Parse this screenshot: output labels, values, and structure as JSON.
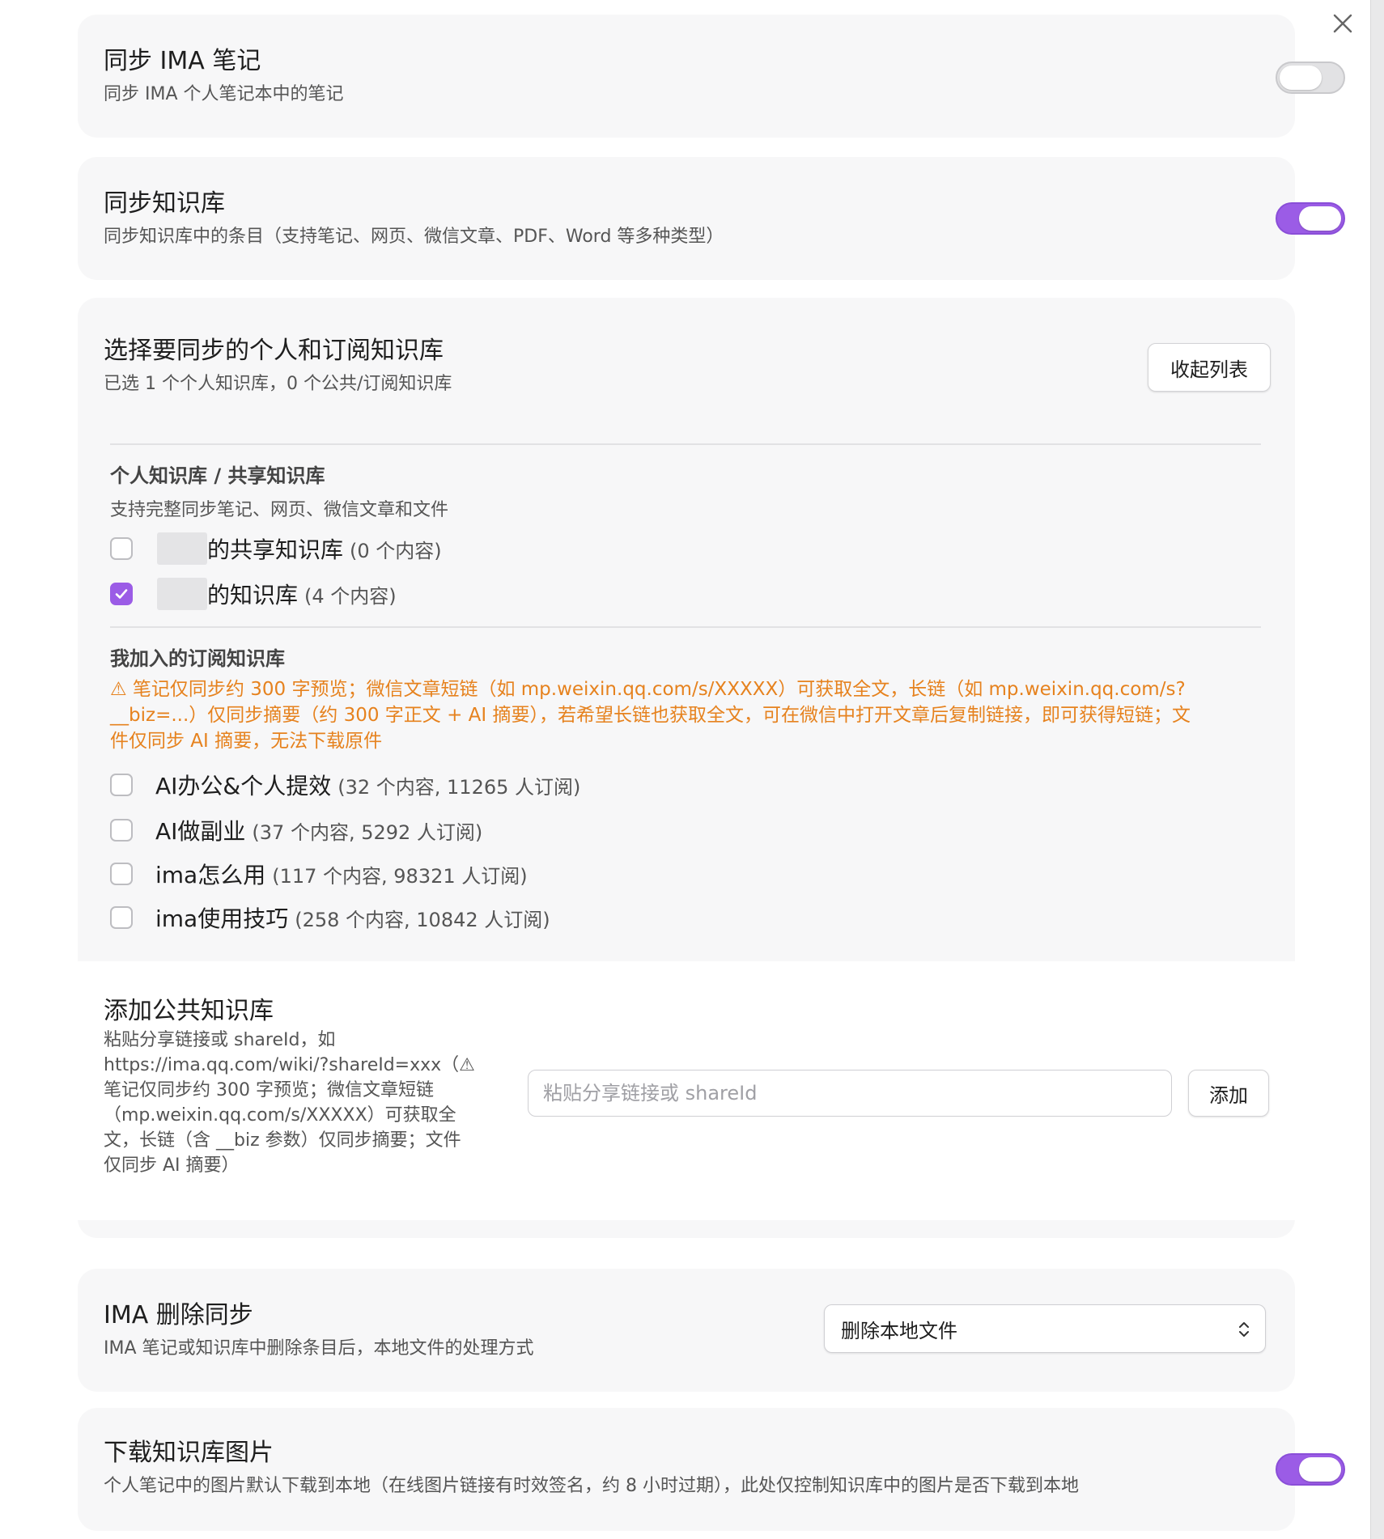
{
  "sync_notes": {
    "title": "同步 IMA 笔记",
    "desc": "同步 IMA 个人笔记本中的笔记",
    "enabled": false
  },
  "sync_kb": {
    "title": "同步知识库",
    "desc": "同步知识库中的条目（支持笔记、网页、微信文章、PDF、Word 等多种类型）",
    "enabled": true
  },
  "select_kb": {
    "title": "选择要同步的个人和订阅知识库",
    "desc": "已选 1 个个人知识库，0 个公共/订阅知识库",
    "collapse_label": "收起列表"
  },
  "personal": {
    "heading": "个人知识库 / 共享知识库",
    "desc": "支持完整同步笔记、网页、微信文章和文件",
    "items": [
      {
        "name": "的共享知识库",
        "meta": "(0 个内容)",
        "checked": false
      },
      {
        "name": "的知识库",
        "meta": "(4 个内容)",
        "checked": true
      }
    ]
  },
  "subscribed": {
    "heading": "我加入的订阅知识库",
    "warning_line1": "⚠ 笔记仅同步约 300 字预览；微信文章短链（如 mp.weixin.qq.com/s/XXXXX）可获取全文，长链（如 mp.weixin.qq.com/s?",
    "warning_line2": "__biz=...）仅同步摘要（约 300 字正文 + AI 摘要），若希望长链也获取全文，可在微信中打开文章后复制链接，即可获得短链；文",
    "warning_line3": "件仅同步 AI 摘要，无法下载原件",
    "items": [
      {
        "name": "AI办公&个人提效",
        "meta": "(32 个内容, 11265 人订阅)",
        "checked": false
      },
      {
        "name": "AI做副业",
        "meta": "(37 个内容, 5292 人订阅)",
        "checked": false
      },
      {
        "name": "ima怎么用",
        "meta": "(117 个内容, 98321 人订阅)",
        "checked": false
      },
      {
        "name": "ima使用技巧",
        "meta": "(258 个内容, 10842 人订阅)",
        "checked": false
      }
    ]
  },
  "add_public": {
    "title": "添加公共知识库",
    "desc_lines": [
      "粘贴分享链接或 shareId，如",
      "https://ima.qq.com/wiki/?shareId=xxx（⚠",
      "笔记仅同步约 300 字预览；微信文章短链",
      "（mp.weixin.qq.com/s/XXXXX）可获取全",
      "文，长链（含 __biz 参数）仅同步摘要；文件",
      "仅同步 AI 摘要）"
    ],
    "input_value": "",
    "input_placeholder": "粘贴分享链接或 shareId",
    "add_label": "添加"
  },
  "delete_sync": {
    "title": "IMA 删除同步",
    "desc": "IMA 笔记或知识库中删除条目后，本地文件的处理方式",
    "selected": "删除本地文件"
  },
  "download_images": {
    "title": "下载知识库图片",
    "desc": "个人笔记中的图片默认下载到本地（在线图片链接有时效签名，约 8 小时过期），此处仅控制知识库中的图片是否下载到本地",
    "enabled": true
  },
  "colors": {
    "accent": "#9b5ce6",
    "warning": "#e6821e"
  },
  "icons": {
    "close": "close-icon",
    "check": "check-icon",
    "select": "chevron-updown-icon"
  }
}
